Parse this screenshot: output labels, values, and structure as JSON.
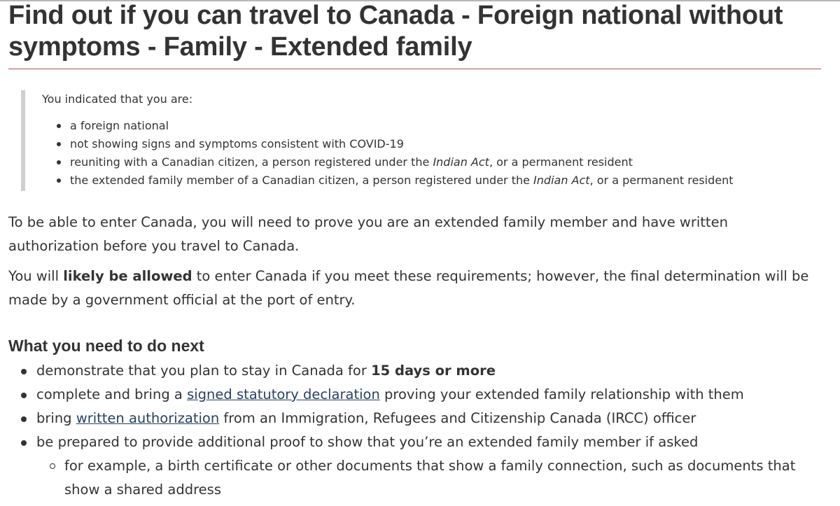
{
  "page": {
    "title": "Find out if you can travel to Canada - Foreign national without symptoms - Family - Extended family"
  },
  "summary": {
    "intro": "You indicated that you are:",
    "items": [
      {
        "text": "a foreign national"
      },
      {
        "text": "not showing signs and symptoms consistent with COVID-19"
      },
      {
        "pre": "reuniting with a Canadian citizen, a person registered under the ",
        "em": "Indian Act",
        "post": ", or a permanent resident"
      },
      {
        "pre": "the extended family member of a Canadian citizen, a person registered under the ",
        "em": "Indian Act",
        "post": ", or a permanent resident"
      }
    ]
  },
  "paragraphs": {
    "p1": "To be able to enter Canada, you will need to prove you are an extended family member and have written authorization before you travel to Canada.",
    "p2_pre": "You will ",
    "p2_bold": "likely be allowed",
    "p2_post": " to enter Canada if you meet these requirements; however, the final determination will be made by a government official at the port of entry."
  },
  "next_steps": {
    "heading": "What you need to do next",
    "items": [
      {
        "pre": "demonstrate that you plan to stay in Canada for ",
        "bold": "15 days or more"
      },
      {
        "pre": "complete and bring a ",
        "link": "signed statutory declaration",
        "post": " proving your extended family relationship with them"
      },
      {
        "pre": "bring ",
        "link": "written authorization",
        "post": " from an Immigration, Refugees and Citizenship Canada (IRCC) officer"
      },
      {
        "pre": "be prepared to provide additional proof to show that you’re an extended family member if asked"
      }
    ],
    "sub_items": [
      {
        "text": "for example, a birth certificate or other documents that show a family connection, such as documents that show a shared address"
      }
    ]
  },
  "colors": {
    "text": "#333333",
    "link": "#284162",
    "title_rule": "#a9534f",
    "summary_border": "#cfcfcf"
  }
}
